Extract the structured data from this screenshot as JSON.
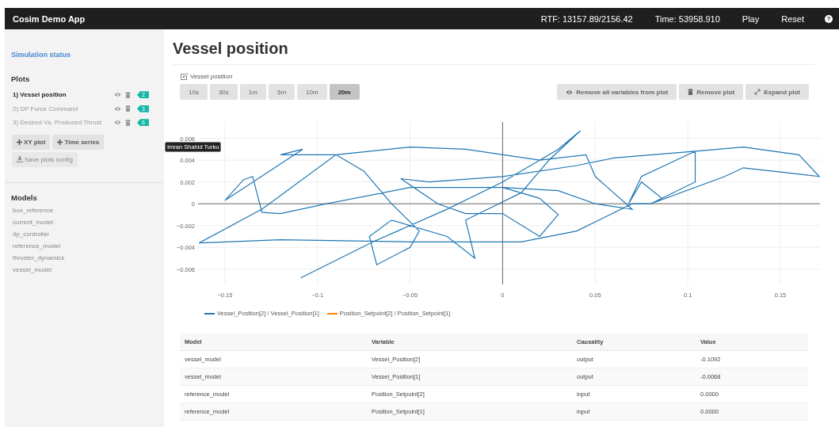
{
  "topbar": {
    "title": "Cosim Demo App",
    "rtf": "RTF: 13157.89/2156.42",
    "time": "Time: 53958.910",
    "actions": [
      "Play",
      "Reset"
    ],
    "help": "?"
  },
  "sidebar": {
    "status_link": "Simulation status",
    "plots_heading": "Plots",
    "plots": [
      {
        "label": "1) Vessel position",
        "count": "2",
        "selected": true
      },
      {
        "label": "2) DP Force Command",
        "count": "3",
        "selected": false
      },
      {
        "label": "3) Desired Vs. Produced Thrust",
        "count": "6",
        "selected": false
      }
    ],
    "add_buttons": [
      "XY plot",
      "Time series"
    ],
    "save_button": {
      "label": "Save plots config",
      "disabled": true
    },
    "models_heading": "Models",
    "models": [
      "box_reference",
      "current_model",
      "dp_controller",
      "reference_model",
      "thruster_dynamics",
      "vessel_model"
    ]
  },
  "main": {
    "title": "Vessel position",
    "plot_name": "Vessel position",
    "ranges": [
      {
        "label": "10s",
        "selected": false
      },
      {
        "label": "30s",
        "selected": false
      },
      {
        "label": "1m",
        "selected": false
      },
      {
        "label": "5m",
        "selected": false
      },
      {
        "label": "10m",
        "selected": false
      },
      {
        "label": "20m",
        "selected": true
      }
    ],
    "actions": [
      {
        "kind": "eye",
        "label": "Remove all variables from plot"
      },
      {
        "kind": "trash",
        "label": "Remove plot"
      },
      {
        "kind": "expand",
        "label": "Expand plot"
      }
    ],
    "tooltip": "Imran Shahid Turku",
    "chart_data": {
      "type": "line",
      "grid": true,
      "xlim": [
        -0.1645,
        0.1714
      ],
      "ylim": [
        -0.0074,
        0.0075
      ],
      "xticks": [
        {
          "value": -0.15,
          "label": "−0.15"
        },
        {
          "value": -0.1,
          "label": "−0.1"
        },
        {
          "value": -0.05,
          "label": "−0.05"
        },
        {
          "value": 0,
          "label": "0"
        },
        {
          "value": 0.05,
          "label": "0.05"
        },
        {
          "value": 0.1,
          "label": "0.1"
        },
        {
          "value": 0.15,
          "label": "0.15"
        }
      ],
      "yticks": [
        {
          "value": -0.006,
          "label": "−0.006"
        },
        {
          "value": -0.004,
          "label": "−0.004"
        },
        {
          "value": -0.002,
          "label": "−0.002"
        },
        {
          "value": 0,
          "label": "0"
        },
        {
          "value": 0.002,
          "label": "0.002"
        },
        {
          "value": 0.004,
          "label": "0.004"
        },
        {
          "value": 0.006,
          "label": "0.006"
        }
      ],
      "x": [
        -0.109,
        -0.07,
        -0.03,
        0.0,
        0.03,
        0.042,
        0.025,
        0.01,
        -0.02,
        -0.015,
        -0.03,
        -0.06,
        -0.072,
        -0.068,
        -0.05,
        -0.045,
        -0.06,
        -0.075,
        -0.09,
        -0.12,
        -0.108,
        -0.15,
        -0.14,
        -0.135,
        -0.13,
        -0.12,
        -0.095,
        -0.05,
        0.0,
        0.03,
        0.05,
        0.07,
        0.05,
        0.045,
        0.02,
        -0.02,
        -0.05,
        -0.09,
        -0.13,
        -0.164,
        -0.12,
        -0.05,
        0.01,
        0.04,
        0.07,
        0.08,
        0.086,
        0.075,
        0.068,
        0.075,
        0.1,
        0.104,
        0.104,
        0.08,
        0.12,
        0.13,
        0.171,
        0.16,
        0.13,
        0.103,
        0.06,
        0.04,
        0.0,
        -0.04,
        -0.055,
        -0.035,
        -0.02,
        0.0,
        0.02,
        0.03,
        0.02,
        0.0
      ],
      "series": [
        {
          "name": "Vessel_Position[2] / Vessel_Position[1]",
          "color": "#1f77b4",
          "values": [
            -0.0068,
            -0.0035,
            -0.0005,
            0.002,
            0.005,
            0.0067,
            0.004,
            0.001,
            -0.0015,
            -0.005,
            -0.003,
            -0.0015,
            -0.003,
            -0.0056,
            -0.004,
            -0.0025,
            0.0,
            0.003,
            0.0045,
            0.0045,
            0.005,
            0.0003,
            0.0022,
            0.0025,
            -0.0008,
            -0.0009,
            0.0,
            0.0015,
            0.0015,
            0.0012,
            0.0,
            -0.0005,
            0.0025,
            0.0045,
            0.004,
            0.005,
            0.0052,
            0.0045,
            -0.0005,
            -0.0036,
            -0.0033,
            -0.0035,
            -0.0035,
            -0.0025,
            0.0,
            0.0,
            0.0005,
            0.002,
            0.0,
            0.0025,
            0.0045,
            0.0048,
            0.002,
            0.0,
            0.0025,
            0.0033,
            0.0025,
            0.0045,
            0.0052,
            0.0048,
            0.0042,
            0.0035,
            0.0025,
            0.002,
            0.0023,
            0.0,
            -0.0009,
            -0.0009,
            -0.003,
            -0.001,
            0.0005,
            0.0015
          ]
        },
        {
          "name": "Position_Setpoint[2] / Position_Setpoint[1]",
          "color": "#ff7f0e",
          "values": [
            null,
            null,
            null,
            null,
            null,
            null,
            null,
            null,
            null,
            null,
            null,
            null,
            null,
            null,
            null,
            null,
            null,
            null,
            null,
            null,
            null,
            null,
            null,
            null,
            null,
            null,
            null,
            null,
            null,
            null,
            null,
            null,
            null,
            null,
            null,
            null,
            null,
            null,
            null,
            null,
            null,
            null,
            null,
            null,
            null,
            null,
            null,
            null,
            null,
            null,
            null,
            null,
            null,
            null,
            null,
            null,
            null,
            null,
            null,
            null,
            null,
            null,
            null,
            null,
            null,
            null,
            null,
            null,
            null,
            null,
            null,
            null
          ]
        }
      ]
    },
    "table": {
      "columns": [
        "Model",
        "Variable",
        "Causality",
        "Value"
      ],
      "rows": [
        [
          "vessel_model",
          "Vessel_Position[2]",
          "output",
          "-0.1092"
        ],
        [
          "vessel_model",
          "Vessel_Position[1]",
          "output",
          "-0.0068"
        ],
        [
          "reference_model",
          "Position_Setpoint[2]",
          "input",
          "0.0000"
        ],
        [
          "reference_model",
          "Position_Setpoint[1]",
          "input",
          "0.0000"
        ]
      ]
    }
  }
}
